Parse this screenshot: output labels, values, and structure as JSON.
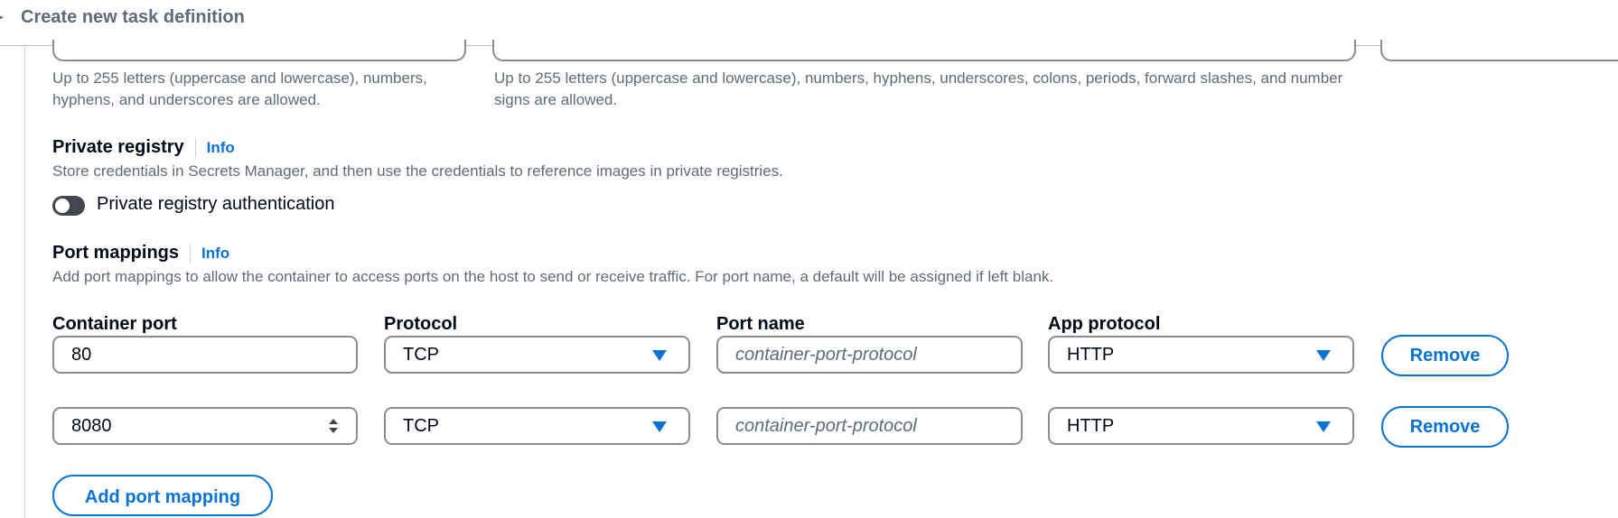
{
  "header": {
    "title": "Create new task definition"
  },
  "image_uri_help": "Up to 255 letters (uppercase and lowercase), numbers, hyphens, and underscores are allowed.",
  "name_help": "Up to 255 letters (uppercase and lowercase), numbers, hyphens, underscores, colons, periods, forward slashes, and number signs are allowed.",
  "private_registry": {
    "title": "Private registry",
    "info": "Info",
    "description": "Store credentials in Secrets Manager, and then use the credentials to reference images in private registries.",
    "toggle_label": "Private registry authentication",
    "enabled": false
  },
  "port_mappings": {
    "title": "Port mappings",
    "info": "Info",
    "description": "Add port mappings to allow the container to access ports on the host to send or receive traffic. For port name, a default will be assigned if left blank.",
    "columns": {
      "container_port": "Container port",
      "protocol": "Protocol",
      "port_name": "Port name",
      "app_protocol": "App protocol"
    },
    "rows": [
      {
        "container_port": "80",
        "protocol": "TCP",
        "port_name_placeholder": "container-port-protocol",
        "app_protocol": "HTTP",
        "remove_label": "Remove"
      },
      {
        "container_port": "8080",
        "protocol": "TCP",
        "port_name_placeholder": "container-port-protocol",
        "app_protocol": "HTTP",
        "remove_label": "Remove"
      }
    ],
    "add_label": "Add port mapping"
  }
}
